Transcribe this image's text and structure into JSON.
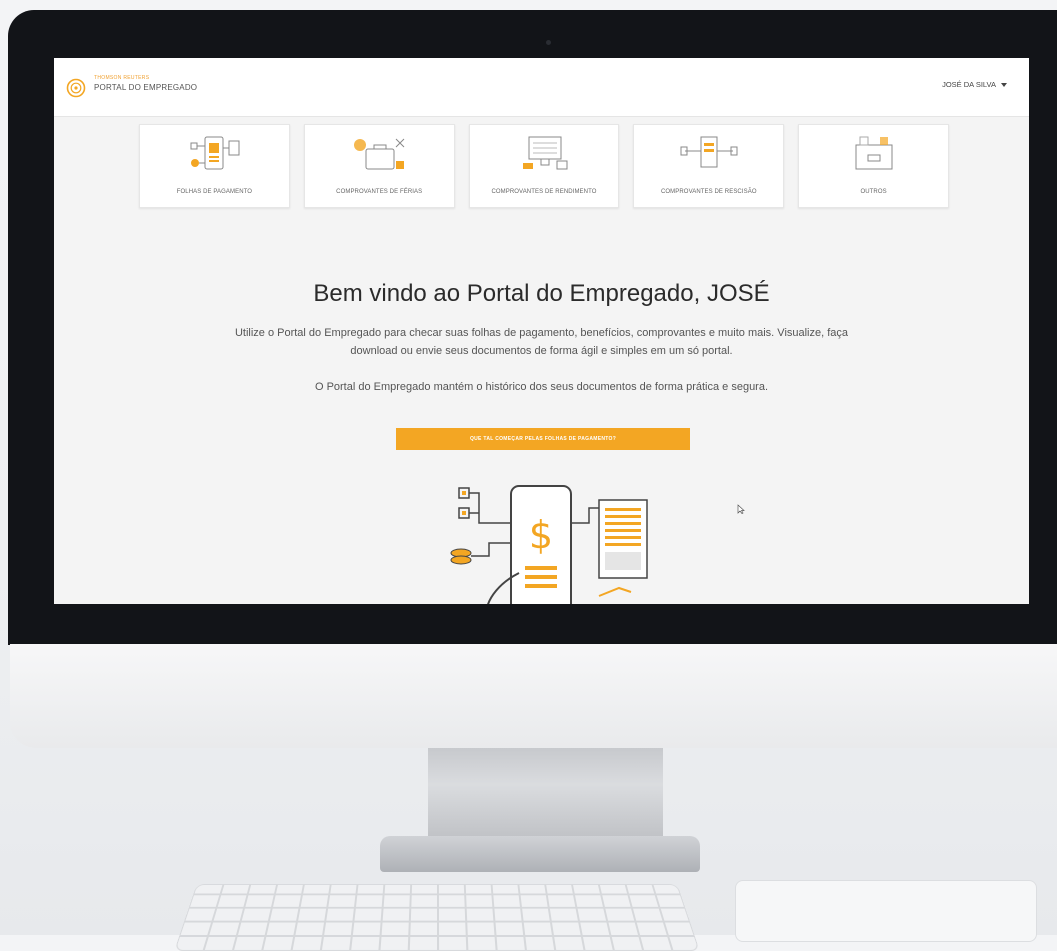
{
  "header": {
    "brand_small": "THOMSON REUTERS",
    "brand_title": "PORTAL DO EMPREGADO",
    "user_name": "JOSÉ DA SILVA"
  },
  "cards": [
    {
      "label": "FOLHAS DE PAGAMENTO",
      "icon": "payroll-icon"
    },
    {
      "label": "COMPROVANTES DE FÉRIAS",
      "icon": "vacation-icon"
    },
    {
      "label": "COMPROVANTES DE RENDIMENTO",
      "icon": "income-icon"
    },
    {
      "label": "COMPROVANTES DE RESCISÃO",
      "icon": "termination-icon"
    },
    {
      "label": "OUTROS",
      "icon": "others-icon"
    }
  ],
  "main": {
    "title": "Bem vindo ao Portal do Empregado, JOSÉ",
    "description": "Utilize o Portal do Empregado para checar suas folhas de pagamento, benefícios, comprovantes e muito mais. Visualize, faça download ou envie seus documentos de forma ágil e simples em um só portal.",
    "history": "O Portal do Empregado mantém o histórico dos seus documentos de forma prática e segura.",
    "cta_label": "QUE TAL COMEÇAR PELAS FOLHAS DE PAGAMENTO?"
  },
  "colors": {
    "accent": "#f3a623",
    "background": "#f4f4f4",
    "bezel": "#121418"
  }
}
